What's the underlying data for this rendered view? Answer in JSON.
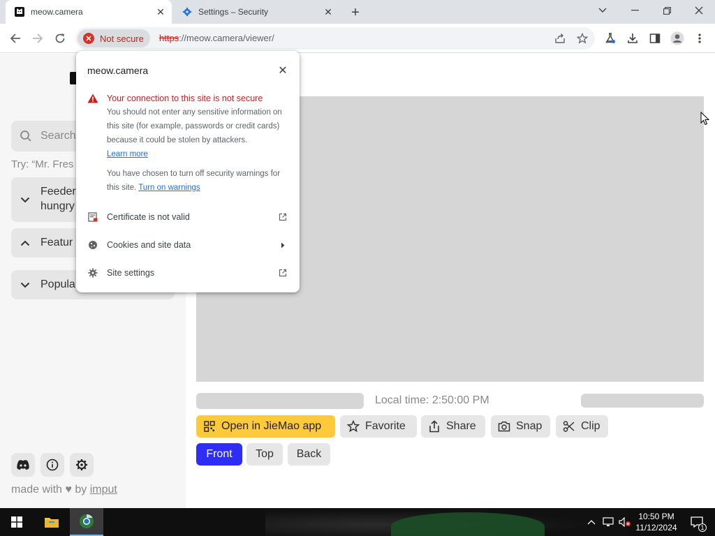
{
  "browser": {
    "tabs": [
      {
        "title": "meow.camera",
        "icon": "cat-icon"
      },
      {
        "title": "Settings – Security",
        "icon": "gear-icon"
      }
    ],
    "address": {
      "security_chip": "Not secure",
      "url_scheme": "https",
      "url_rest": "://meow.camera/viewer/"
    }
  },
  "popup": {
    "site": "meow.camera",
    "warning_title": "Your connection to this site is not secure",
    "warning_body": "You should not enter any sensitive information on this site (for example, passwords or credit cards) because it could be stolen by attackers.",
    "learn_more": "Learn more",
    "chosen_text": "You have chosen to turn off security warnings for this site.",
    "turn_on_warnings": "Turn on warnings",
    "rows": [
      {
        "label": "Certificate is not valid",
        "icon": "certificate-icon",
        "end": "external-link-icon"
      },
      {
        "label": "Cookies and site data",
        "icon": "cookie-icon",
        "end": "chevron-right-icon"
      },
      {
        "label": "Site settings",
        "icon": "gear-icon",
        "end": "external-link-icon"
      }
    ]
  },
  "sidebar": {
    "search_placeholder": "Search",
    "try_text": "Try: “Mr. Fres",
    "accordions": [
      {
        "line1": "Feeder",
        "line2": "hungry",
        "state": "collapsed"
      },
      {
        "line1": "Featur",
        "state": "expanded"
      },
      {
        "line1": "Popula",
        "state": "collapsed"
      }
    ],
    "footer": {
      "made_with": "made with",
      "by": "by",
      "author": "imput"
    }
  },
  "main": {
    "local_time": "Local time: 2:50:00 PM",
    "actions": [
      {
        "label": "Open in JieMao app",
        "icon": "qr-code-icon"
      },
      {
        "label": "Favorite",
        "icon": "star-icon"
      },
      {
        "label": "Share",
        "icon": "share-icon"
      },
      {
        "label": "Snap",
        "icon": "camera-icon"
      },
      {
        "label": "Clip",
        "icon": "scissors-icon"
      }
    ],
    "views": [
      {
        "label": "Front",
        "active": true
      },
      {
        "label": "Top",
        "active": false
      },
      {
        "label": "Back",
        "active": false
      }
    ]
  },
  "taskbar": {
    "time": "10:50 PM",
    "date": "11/12/2024",
    "notification_count": "1"
  },
  "colors": {
    "accent_blue": "#2d2df5",
    "accent_yellow": "#ffc93c",
    "warning_red": "#c5221f",
    "link_blue": "#1a73e8"
  }
}
